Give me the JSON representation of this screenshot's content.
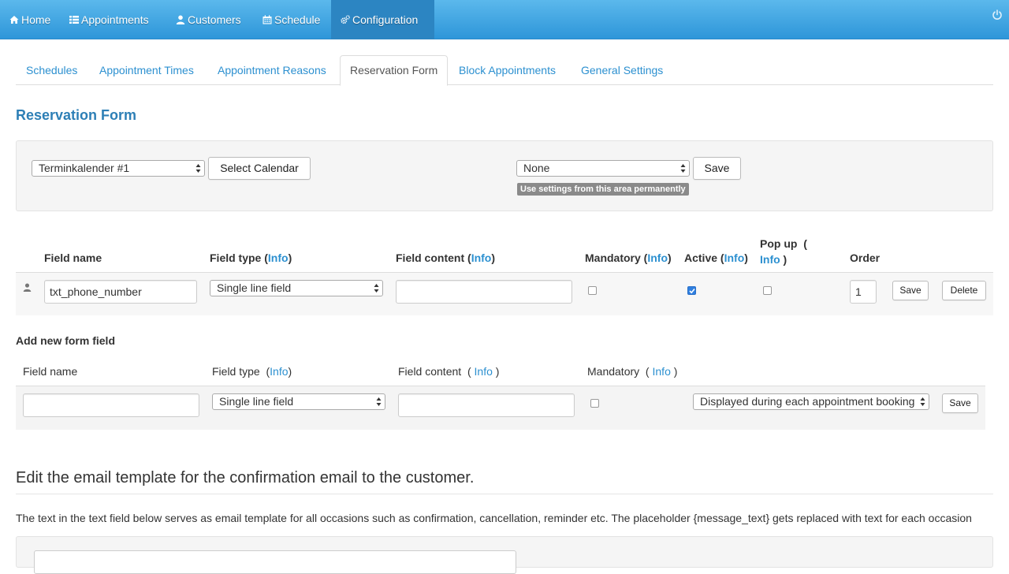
{
  "nav": {
    "items": [
      {
        "label": "Home",
        "icon": "home-icon"
      },
      {
        "label": "Appointments",
        "icon": "list-icon"
      },
      {
        "label": "Customers",
        "icon": "user-icon"
      },
      {
        "label": "Schedule",
        "icon": "calendar-icon"
      },
      {
        "label": "Configuration",
        "icon": "cogs-icon"
      }
    ],
    "active": "Configuration",
    "right_icon": "power-icon"
  },
  "tabs": {
    "items": [
      "Schedules",
      "Appointment Times",
      "Appointment Reasons",
      "Reservation Form",
      "Block Appointments",
      "General Settings"
    ],
    "active": "Reservation Form"
  },
  "page_title": "Reservation Form",
  "well": {
    "calendar_select": "Terminkalender #1",
    "select_calendar_button": "Select Calendar",
    "area_select": "None",
    "save_button": "Save",
    "permanent_label": "Use settings from this area permanently"
  },
  "fields_table": {
    "headers": {
      "field_name": "Field name",
      "field_type": "Field type",
      "field_content": "Field content",
      "mandatory": "Mandatory",
      "active": "Active",
      "popup": "Pop up",
      "order": "Order",
      "info": "Info"
    },
    "rows": [
      {
        "icon": "user-icon",
        "field_name": "txt_phone_number",
        "field_type": "Single line field",
        "field_content": "",
        "mandatory": false,
        "active": true,
        "popup": false,
        "order": "1",
        "save": "Save",
        "delete": "Delete"
      }
    ]
  },
  "new_field": {
    "title": "Add new form field",
    "headers": {
      "field_name": "Field name",
      "field_type": "Field type",
      "field_content": "Field content",
      "mandatory": "Mandatory",
      "info": "Info"
    },
    "field_name": "",
    "field_type": "Single line field",
    "field_content": "",
    "mandatory": false,
    "display_option": "Displayed during each appointment booking",
    "save": "Save"
  },
  "email": {
    "heading": "Edit the email template for the confirmation email to the customer.",
    "description": "The text in the text field below serves as email template for all occasions such as confirmation, cancellation, reminder etc. The placeholder {message_text} gets replaced with text for each occasion"
  },
  "colors": {
    "navbar": "#2e96d9",
    "link": "#2c90d0",
    "title": "#2d7fb6",
    "checkbox_checked": "#2f7fe0"
  }
}
